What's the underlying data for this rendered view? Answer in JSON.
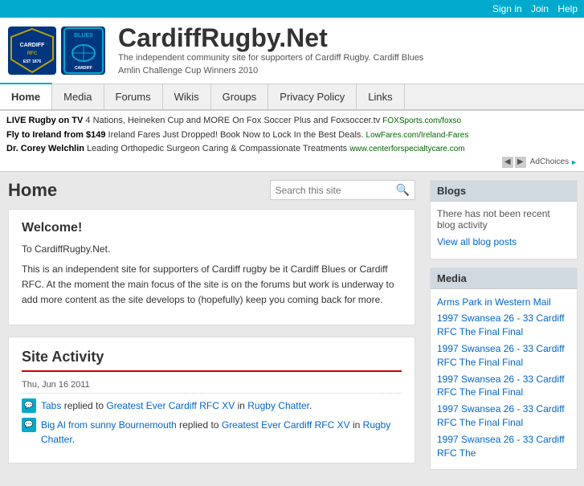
{
  "topbar": {
    "signin_label": "Sign in",
    "join_label": "Join",
    "help_label": "Help"
  },
  "header": {
    "site_name": "CardiffRugby.Net",
    "tagline_line1": "The independent community site for supporters of Cardiff Rugby. Cardiff Blues",
    "tagline_line2": "Amlin Challenge Cup Winners 2010"
  },
  "nav": {
    "items": [
      {
        "label": "Home",
        "active": true
      },
      {
        "label": "Media",
        "active": false
      },
      {
        "label": "Forums",
        "active": false
      },
      {
        "label": "Wikis",
        "active": false
      },
      {
        "label": "Groups",
        "active": false
      },
      {
        "label": "Privacy Policy",
        "active": false
      },
      {
        "label": "Links",
        "active": false
      }
    ]
  },
  "ads": {
    "lines": [
      {
        "title": "LIVE Rugby on TV",
        "body": "4 Nations, Heineken Cup and MORE On Fox Soccer Plus and Foxsoccer.tv",
        "url": "FOXSports.com/foxso"
      },
      {
        "title": "Fly to Ireland from $149",
        "body": "Ireland Fares Just Dropped! Book Now to Lock In the Best Deals.",
        "url": "LowFares.com/Ireland-Fares"
      },
      {
        "title": "Dr. Corey Welchlin",
        "body": "Leading Orthopedic Surgeon Caring & Compassionate Treatments",
        "url": "www.centerforspecialtycare.com"
      }
    ],
    "ad_choices": "AdChoices"
  },
  "page": {
    "title": "Home",
    "search_placeholder": "Search this site"
  },
  "welcome": {
    "heading": "Welcome!",
    "para1": "To CardiffRugby.Net.",
    "para2": "This is an independent site for supporters of Cardiff rugby be it Cardiff Blues or Cardiff RFC. At the moment the main focus of the site is on the forums but work is underway to add more content as the site develops to (hopefully) keep you coming back for more."
  },
  "site_activity": {
    "heading": "Site Activity",
    "date": "Thu, Jun 16 2011",
    "items": [
      {
        "user": "Tabs",
        "action": "replied to",
        "link_text": "Greatest Ever Cardiff RFC XV",
        "location": "Rugby Chatter"
      },
      {
        "user": "Big Al from sunny Bournemouth",
        "action": "replied to",
        "link_text": "Greatest Ever Cardiff RFC XV",
        "location": "Rugby Chatter"
      }
    ]
  },
  "sidebar": {
    "blogs": {
      "title": "Blogs",
      "no_activity": "There has not been recent blog activity",
      "view_all": "View all blog posts"
    },
    "media": {
      "title": "Media",
      "items": [
        "Arms Park in Western Mail",
        "1997 Swansea 26 - 33 Cardiff RFC The Final Final",
        "1997 Swansea 26 - 33 Cardiff RFC The Final Final",
        "1997 Swansea 26 - 33 Cardiff RFC The Final Final",
        "1997 Swansea 26 - 33 Cardiff RFC The Final Final",
        "1997 Swansea 26 - 33 Cardiff RFC The"
      ]
    }
  }
}
